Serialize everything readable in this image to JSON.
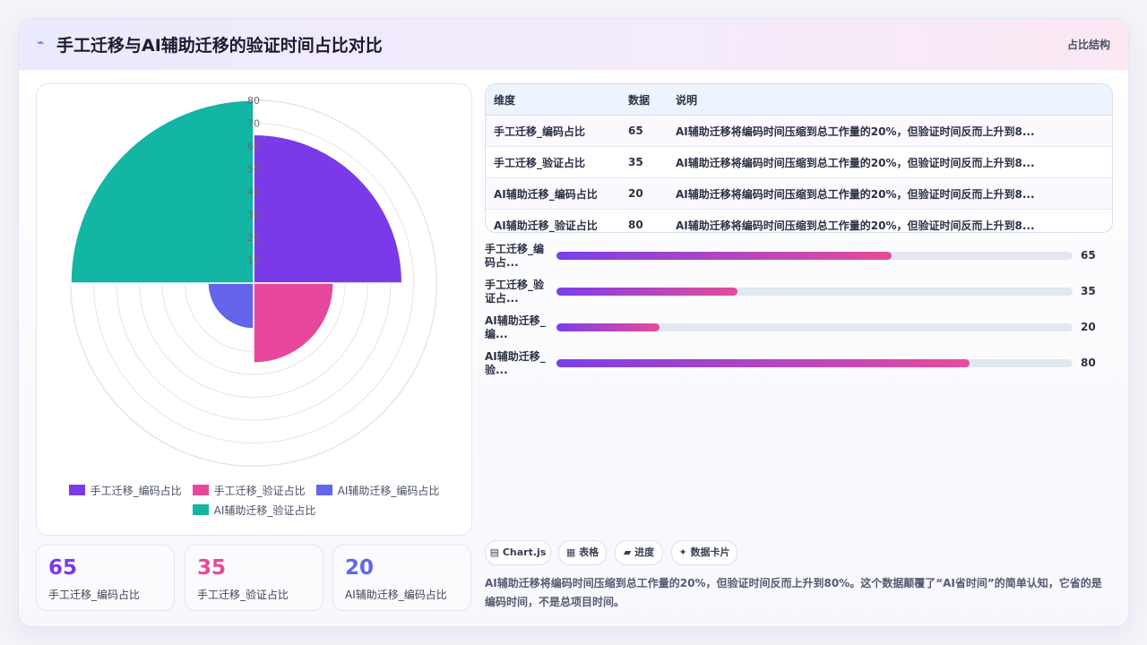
{
  "header": {
    "icon": "trend-line-icon",
    "title": "手工迁移与AI辅助迁移的验证时间占比对比",
    "tag": "占比结构"
  },
  "chart_data": {
    "type": "polarArea",
    "categories": [
      "手工迁移_编码占比",
      "手工迁移_验证占比",
      "AI辅助迁移_编码占比",
      "AI辅助迁移_验证占比"
    ],
    "values": [
      65,
      35,
      20,
      80
    ],
    "colors": [
      "#7a3ae8",
      "#e8489b",
      "#6366ea",
      "#13b5a4"
    ],
    "r_ticks": [
      10,
      20,
      30,
      40,
      50,
      60,
      70,
      80
    ],
    "r_range": [
      0,
      80
    ],
    "legend_position": "bottom"
  },
  "stats": [
    {
      "value": "65",
      "label": "手工迁移_编码占比",
      "color": "#7a3ae8"
    },
    {
      "value": "35",
      "label": "手工迁移_验证占比",
      "color": "#e8489b"
    },
    {
      "value": "20",
      "label": "AI辅助迁移_编码占比",
      "color": "#6366ea"
    }
  ],
  "table": {
    "headers": [
      "维度",
      "数据",
      "说明"
    ],
    "rows": [
      {
        "dim": "手工迁移_编码占比",
        "val": "65",
        "desc": "AI辅助迁移将编码时间压缩到总工作量的20%，但验证时间反而上升到8..."
      },
      {
        "dim": "手工迁移_验证占比",
        "val": "35",
        "desc": "AI辅助迁移将编码时间压缩到总工作量的20%，但验证时间反而上升到8..."
      },
      {
        "dim": "AI辅助迁移_编码占比",
        "val": "20",
        "desc": "AI辅助迁移将编码时间压缩到总工作量的20%，但验证时间反而上升到8..."
      },
      {
        "dim": "AI辅助迁移_验证占比",
        "val": "80",
        "desc": "AI辅助迁移将编码时间压缩到总工作量的20%，但验证时间反而上升到8..."
      }
    ]
  },
  "bars": [
    {
      "label": "手工迁移_编码占...",
      "value": 65
    },
    {
      "label": "手工迁移_验证占...",
      "value": 35
    },
    {
      "label": "AI辅助迁移_编...",
      "value": 20
    },
    {
      "label": "AI辅助迁移_验...",
      "value": 80
    }
  ],
  "chips": [
    {
      "icon": "chart-icon",
      "glyph": "▤",
      "label": "Chart.js"
    },
    {
      "icon": "table-icon",
      "glyph": "▦",
      "label": "表格"
    },
    {
      "icon": "progress-icon",
      "glyph": "▰",
      "label": "进度"
    },
    {
      "icon": "sparkle-icon",
      "glyph": "✦",
      "label": "数据卡片"
    }
  ],
  "note": "AI辅助迁移将编码时间压缩到总工作量的20%，但验证时间反而上升到80%。这个数据颠覆了“AI省时间”的简单认知，它省的是编码时间，不是总项目时间。"
}
